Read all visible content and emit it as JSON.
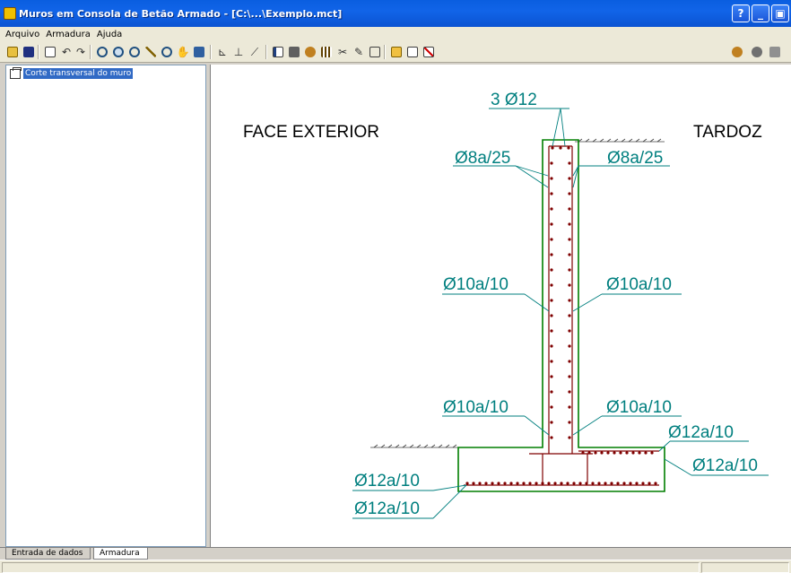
{
  "window": {
    "title": "Muros em Consola de Betão Armado - [C:\\...\\Exemplo.mct]",
    "buttons": {
      "help": "?",
      "minimize": "_",
      "restore": "▣",
      "close": "X"
    }
  },
  "menu": {
    "items": [
      "Arquivo",
      "Armadura",
      "Ajuda"
    ]
  },
  "toolbar": {
    "icons": [
      "open-icon",
      "save-icon",
      "print-icon",
      "undo-icon",
      "redo-icon",
      "zoom-window-icon",
      "zoom-in-icon",
      "zoom-out-icon",
      "measure-icon",
      "zoom-extents-icon",
      "pan-icon",
      "refresh-icon",
      "dimension-x-icon",
      "dimension-y-icon",
      "dimension-oblique-icon",
      "layout-icon",
      "layers-icon",
      "settings-icon",
      "grid-icon",
      "delete-rebar-icon",
      "edit-rebar-icon",
      "view-3d-icon",
      "insert-icon",
      "add-icon",
      "remove-icon",
      "help-tool-icon",
      "render-icon",
      "camera-icon"
    ]
  },
  "tree": {
    "item_label": "Corte transversal do muro"
  },
  "drawing": {
    "face_exterior": "FACE EXTERIOR",
    "tardoz": "TARDOZ",
    "top_bars": "3 Ø12",
    "left_top": "Ø8a/25",
    "right_top": "Ø8a/25",
    "left_mid": "Ø10a/10",
    "right_mid": "Ø10a/10",
    "left_low": "Ø10a/10",
    "right_low": "Ø10a/10",
    "heel_top": "Ø12a/10",
    "heel_right": "Ø12a/10",
    "base_left_top": "Ø12a/10",
    "base_left_bottom": "Ø12a/10",
    "colors": {
      "label": "#007f7f",
      "wall": "#007f00",
      "rebar": "#7f0000"
    }
  },
  "tabs": {
    "items": [
      "Entrada de dados",
      "Armadura"
    ],
    "active": "Armadura"
  }
}
